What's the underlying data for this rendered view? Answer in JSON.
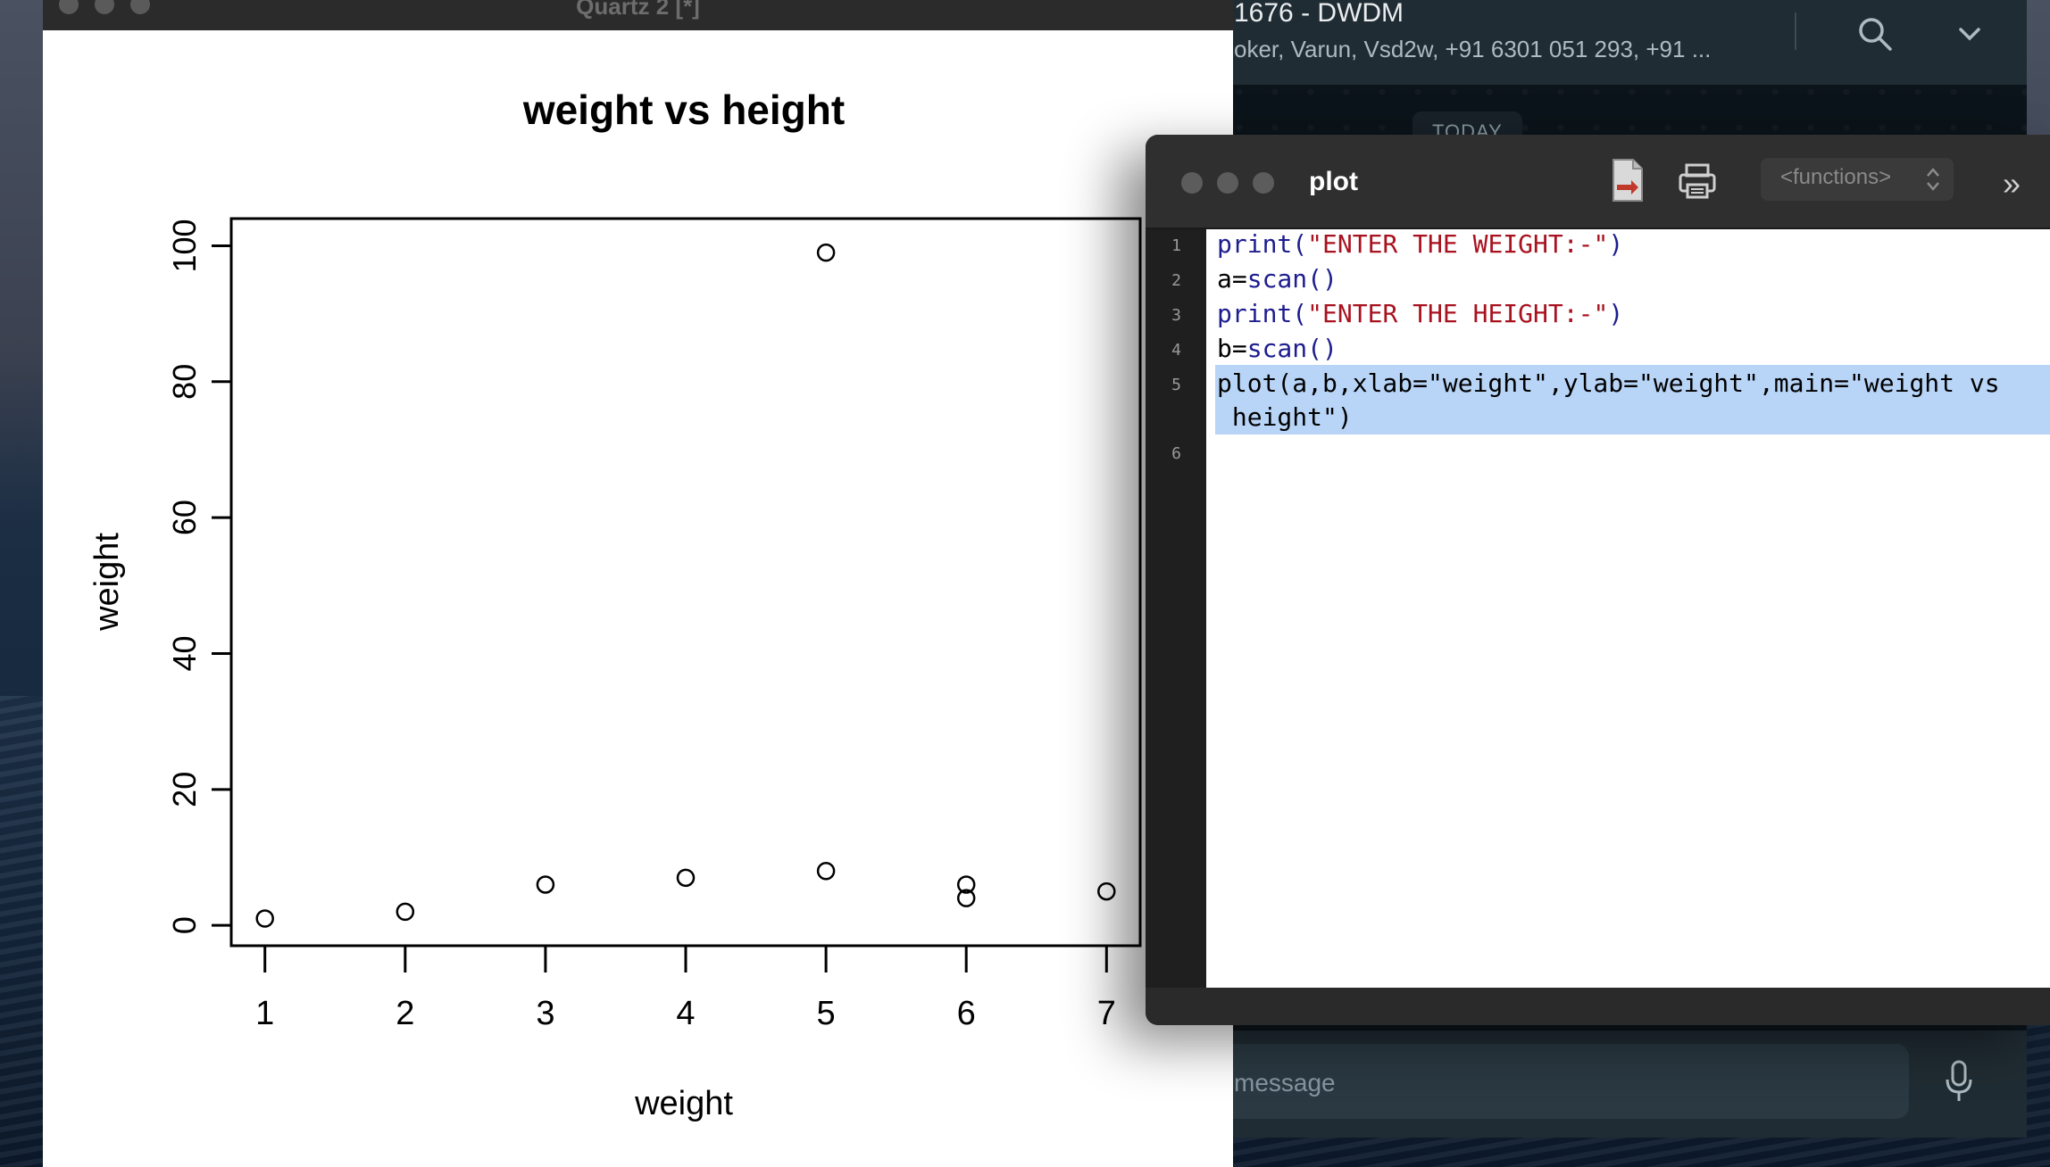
{
  "whatsapp": {
    "chat_title": "1676 - DWDM",
    "participants": "oker, Varun, Vsd2w, +91 6301 051 293, +91 ...",
    "date_chip": "TODAY",
    "message_placeholder": "message",
    "icons": [
      "search-icon",
      "chevron-down-icon",
      "microphone-icon"
    ]
  },
  "quartz_window": {
    "title": "Quartz 2 [*]"
  },
  "chart_data": {
    "type": "scatter",
    "title": "weight vs height",
    "xlabel": "weight",
    "ylabel": "weight",
    "x_ticks": [
      "1",
      "2",
      "3",
      "4",
      "5",
      "6",
      "7"
    ],
    "y_ticks": [
      "0",
      "20",
      "40",
      "60",
      "80",
      "100"
    ],
    "xlim": [
      0.76,
      7.24
    ],
    "ylim": [
      -3,
      104
    ],
    "points": [
      {
        "x": 1,
        "y": 1
      },
      {
        "x": 2,
        "y": 2
      },
      {
        "x": 3,
        "y": 6
      },
      {
        "x": 4,
        "y": 7
      },
      {
        "x": 5,
        "y": 99
      },
      {
        "x": 5,
        "y": 8
      },
      {
        "x": 6,
        "y": 6
      },
      {
        "x": 6,
        "y": 4
      },
      {
        "x": 7,
        "y": 5
      }
    ],
    "marker": "open-circle",
    "grid": false
  },
  "editor": {
    "title": "plot",
    "functions_menu": "<functions>",
    "more_label": "»",
    "line_numbers": [
      "1",
      "2",
      "3",
      "4",
      "5",
      "",
      "6"
    ],
    "lines": [
      {
        "fn": "print(",
        "str": "\"ENTER THE WEIGHT:-\"",
        "end": ")"
      },
      {
        "plain": "a=",
        "fn": "scan()"
      },
      {
        "fn": "print(",
        "str": "\"ENTER THE HEIGHT:-\"",
        "end": ")"
      },
      {
        "plain": "b=",
        "fn": "scan()"
      },
      {
        "text": "plot(a,b,xlab=\"weight\",ylab=\"weight\",main=\"weight vs"
      },
      {
        "text": " height\")"
      }
    ],
    "icons": [
      "document-icon",
      "print-icon"
    ]
  }
}
